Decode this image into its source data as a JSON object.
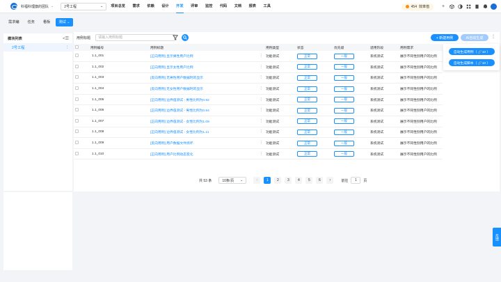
{
  "header": {
    "team_name": "科福科理旗的团队",
    "project": "2号工程",
    "nav": [
      "项目总览",
      "需求",
      "依赖",
      "设计",
      "开发",
      "评审",
      "监控",
      "代码",
      "文档",
      "报表",
      "工具"
    ],
    "active_nav": 4,
    "coins": "454",
    "efficiency_label": "效率值"
  },
  "subtabs": [
    "需求编",
    "任务",
    "看板",
    "测试"
  ],
  "active_subtab": 3,
  "sidebar": {
    "title": "模块列表",
    "items": [
      {
        "label": "2号工程"
      }
    ]
  },
  "toolbar": {
    "filter_label": "用例标题",
    "search_placeholder": "请输入用例标题",
    "new_button": "+ 新建用例",
    "auto_button": "AI自动生成"
  },
  "popup": {
    "gen_cases": "自动生成用例（ 🔗10 ）",
    "gen_scripts": "自动生成脚本（ 🔗10 ）"
  },
  "table": {
    "columns": [
      "用例编号",
      "用例标题",
      "用例类型",
      "状态",
      "优先级",
      "适用阶段",
      "用例需求"
    ],
    "rows": [
      {
        "id": "1.1_001",
        "title": "[正向用例] 显示男性用户比例",
        "type": "功能测试",
        "status": "正常",
        "priority": "一般",
        "stage": "系统测试",
        "req": "展示不同性别用户的比例"
      },
      {
        "id": "1.1_002",
        "title": "[正向用例] 显示女性用户比例",
        "type": "功能测试",
        "status": "正常",
        "priority": "一般",
        "stage": "系统测试",
        "req": "展示不同性别用户的比例"
      },
      {
        "id": "1.1_003",
        "title": "[反向用例] 无男性用户数据时的显示",
        "type": "功能测试",
        "status": "正常",
        "priority": "一般",
        "stage": "系统测试",
        "req": "展示不同性别用户的比例"
      },
      {
        "id": "1.1_004",
        "title": "[反向用例] 无女性用户数据时的显示",
        "type": "功能测试",
        "status": "正常",
        "priority": "一般",
        "stage": "系统测试",
        "req": "展示不同性别用户的比例"
      },
      {
        "id": "1.1_005",
        "title": "[正向用例] 边界值测试 - 男性比例为0.92",
        "type": "功能测试",
        "status": "正常",
        "priority": "一般",
        "stage": "系统测试",
        "req": "展示不同性别用户的比例"
      },
      {
        "id": "1.1_006",
        "title": "[正向用例] 边界值测试 - 男性比例为0.94",
        "type": "功能测试",
        "status": "正常",
        "priority": "一般",
        "stage": "系统测试",
        "req": "展示不同性别用户的比例"
      },
      {
        "id": "1.1_007",
        "title": "[正向用例] 边界值测试 - 女性比例为1.09",
        "type": "功能测试",
        "status": "正常",
        "priority": "一般",
        "stage": "系统测试",
        "req": "展示不同性别用户的比例"
      },
      {
        "id": "1.1_008",
        "title": "[正向用例] 边界值测试 - 女性比例为1.11",
        "type": "功能测试",
        "status": "正常",
        "priority": "一般",
        "stage": "系统测试",
        "req": "展示不同性别用户的比例"
      },
      {
        "id": "1.1_009",
        "title": "[反向用例] 用户数据文件损坏",
        "type": "功能测试",
        "status": "正常",
        "priority": "一般",
        "stage": "系统测试",
        "req": "展示不同性别用户的比例"
      },
      {
        "id": "1.1_010",
        "title": "[正向用例] 用户比例动态变化",
        "type": "功能测试",
        "status": "正常",
        "priority": "一般",
        "stage": "系统测试",
        "req": "展示不同性别用户的比例"
      }
    ]
  },
  "pagination": {
    "total": "共 53 条",
    "page_size": "10条/页",
    "pages": [
      "1",
      "2",
      "3",
      "4",
      "5",
      "6"
    ],
    "current": 0,
    "goto_label": "前往",
    "goto_value": "1",
    "page_suffix": "页"
  },
  "feedback": "反馈"
}
